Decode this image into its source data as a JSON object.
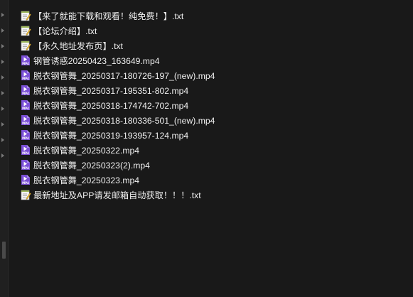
{
  "files": [
    {
      "type": "txt",
      "icon": "text-file-icon",
      "name": "【来了就能下载和观看！纯免费！】.txt"
    },
    {
      "type": "txt",
      "icon": "text-file-icon",
      "name": "【论坛介绍】.txt"
    },
    {
      "type": "txt",
      "icon": "text-file-icon",
      "name": "【永久地址发布页】.txt"
    },
    {
      "type": "mp4",
      "icon": "video-file-icon",
      "name": "钢管诱惑20250423_163649.mp4"
    },
    {
      "type": "mp4",
      "icon": "video-file-icon",
      "name": "脱衣钢管舞_20250317-180726-197_(new).mp4"
    },
    {
      "type": "mp4",
      "icon": "video-file-icon",
      "name": "脱衣钢管舞_20250317-195351-802.mp4"
    },
    {
      "type": "mp4",
      "icon": "video-file-icon",
      "name": "脱衣钢管舞_20250318-174742-702.mp4"
    },
    {
      "type": "mp4",
      "icon": "video-file-icon",
      "name": "脱衣钢管舞_20250318-180336-501_(new).mp4"
    },
    {
      "type": "mp4",
      "icon": "video-file-icon",
      "name": "脱衣钢管舞_20250319-193957-124.mp4"
    },
    {
      "type": "mp4",
      "icon": "video-file-icon",
      "name": "脱衣钢管舞_20250322.mp4"
    },
    {
      "type": "mp4",
      "icon": "video-file-icon",
      "name": "脱衣钢管舞_20250323(2).mp4"
    },
    {
      "type": "mp4",
      "icon": "video-file-icon",
      "name": "脱衣钢管舞_20250323.mp4"
    },
    {
      "type": "txt",
      "icon": "text-file-icon",
      "name": "最新地址及APP请发邮箱自动获取！！！.txt"
    }
  ],
  "colors": {
    "background": "#191919",
    "text": "#f0f0f0",
    "mp4_icon": "#7b4fd6",
    "txt_icon_page": "#f4f4f4",
    "txt_icon_pencil": "#e8b838"
  }
}
